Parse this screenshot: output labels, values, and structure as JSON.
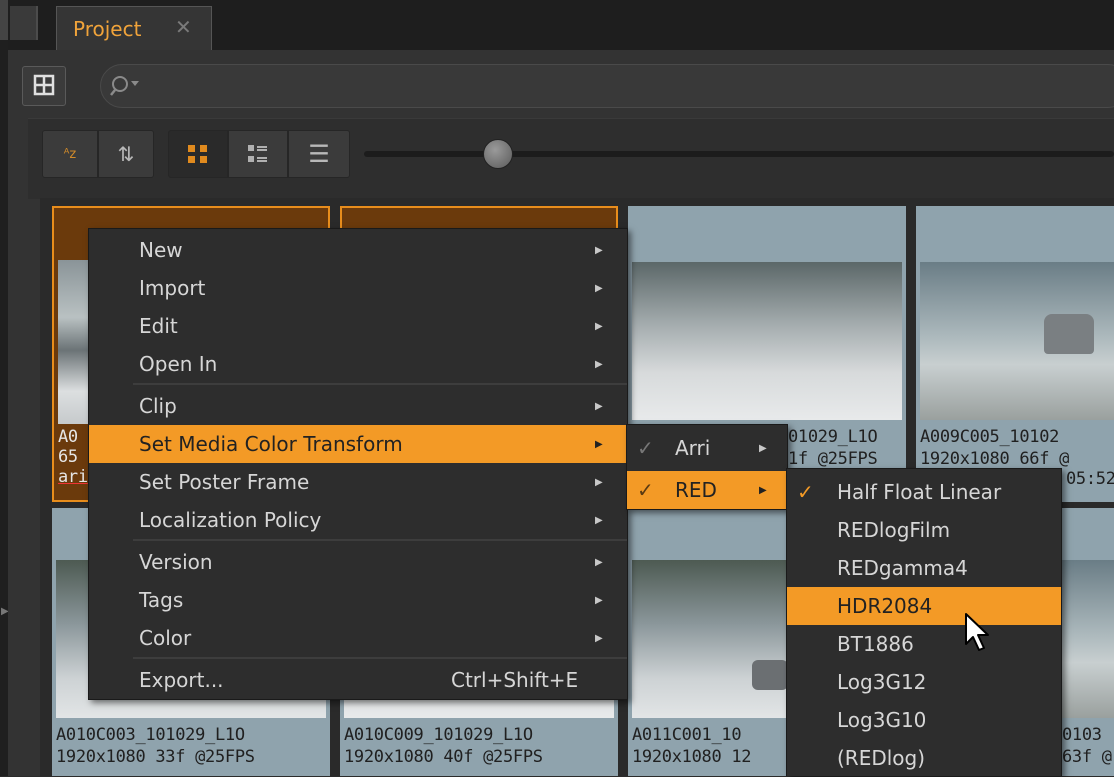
{
  "tab": {
    "title": "Project",
    "close": "✕"
  },
  "icons": {
    "view_toggle": "grid-view-icon",
    "search": "search-icon",
    "sort_alpha": "sort-alpha-icon",
    "sort_order": "sort-order-icon",
    "grid": "grid-icon",
    "detail": "detail-icon",
    "list": "list-icon"
  },
  "toolbar": {
    "sort_alpha_label": "ᴬz",
    "sort_order_glyph": "⇅",
    "list_glyph": "☰"
  },
  "clips": [
    {
      "name": "A0",
      "line2": "65",
      "line3": "ari",
      "selected": true
    },
    {
      "name": "",
      "line2": "",
      "line3": "",
      "selected": true
    },
    {
      "name": "01029_L1O",
      "line2": "1f @25FPS",
      "line3": ""
    },
    {
      "name": "A009C005_10102",
      "line2": "1920x1080  66f @",
      "line3": "05:52"
    },
    {
      "name": "A010C003_101029_L1O",
      "line2": "1920x1080  33f @25FPS"
    },
    {
      "name": "A010C009_101029_L1O",
      "line2": "1920x1080  40f @25FPS"
    },
    {
      "name": "A011C001_10",
      "line2": "1920x1080 12"
    },
    {
      "name": "0103",
      "line2": "63f @"
    }
  ],
  "context_menu": {
    "items": [
      {
        "label": "New"
      },
      {
        "label": "Import"
      },
      {
        "label": "Edit"
      },
      {
        "label": "Open In"
      },
      {
        "label": "Clip"
      },
      {
        "label": "Set Media Color Transform",
        "highlighted": true
      },
      {
        "label": "Set Poster Frame"
      },
      {
        "label": "Localization Policy"
      },
      {
        "label": "Version"
      },
      {
        "label": "Tags"
      },
      {
        "label": "Color"
      },
      {
        "label": "Export...",
        "shortcut": "Ctrl+Shift+E"
      }
    ]
  },
  "submenu_vendor": {
    "items": [
      {
        "label": "Arri",
        "checked": true
      },
      {
        "label": "RED",
        "checked": true,
        "highlighted": true
      }
    ]
  },
  "submenu_red": {
    "items": [
      {
        "label": "Half Float Linear",
        "checked": true
      },
      {
        "label": "REDlogFilm"
      },
      {
        "label": "REDgamma4"
      },
      {
        "label": "HDR2084",
        "highlighted": true
      },
      {
        "label": "BT1886"
      },
      {
        "label": "Log3G12"
      },
      {
        "label": "Log3G10"
      },
      {
        "label": "(REDlog)"
      }
    ]
  },
  "colors": {
    "accent": "#f39a26",
    "tab_text": "#f0a33a",
    "selection_border": "#e88d1c"
  }
}
